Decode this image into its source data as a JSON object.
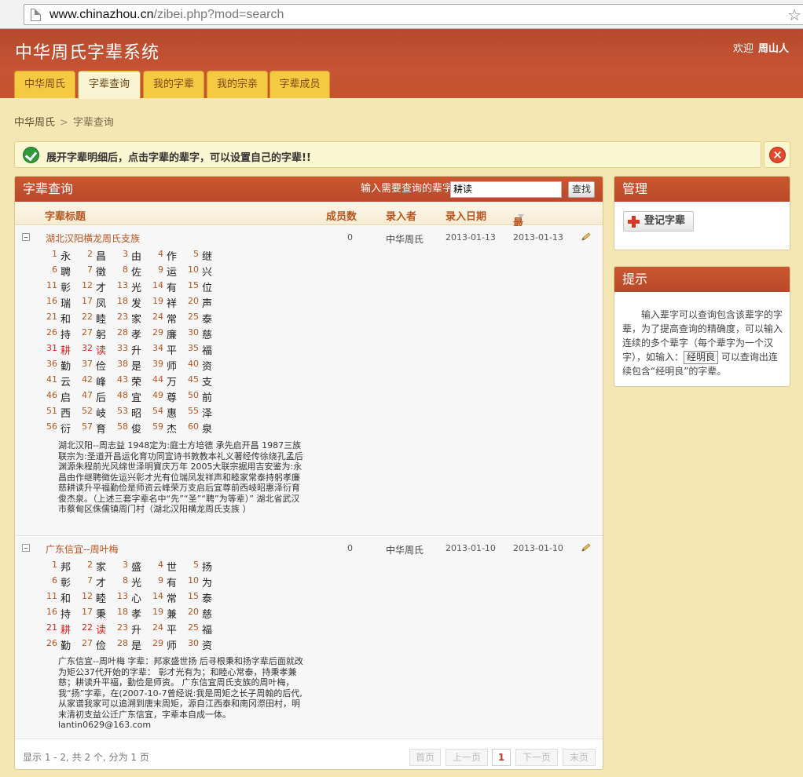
{
  "browser": {
    "url_host": "www.chinazhou.cn",
    "url_rest": "/zibei.php?mod=search"
  },
  "header": {
    "site_title": "中华周氏字辈系统",
    "welcome_label": "欢迎",
    "username": "周山人",
    "tabs": [
      {
        "label": "中华周氏",
        "active": false
      },
      {
        "label": "字辈查询",
        "active": true
      },
      {
        "label": "我的字辈",
        "active": false
      },
      {
        "label": "我的宗亲",
        "active": false
      },
      {
        "label": "字辈成员",
        "active": false
      }
    ]
  },
  "breadcrumb": {
    "home": "中华周氏",
    "sep": ">",
    "current": "字辈查询"
  },
  "notice": {
    "message": "展开字辈明细后，点击字辈的辈字，可以设置自己的字辈!!",
    "close": "×"
  },
  "search": {
    "title": "字辈查询",
    "label": "输入需要查询的辈字",
    "value": "耕读",
    "button": "查找"
  },
  "table": {
    "headers": {
      "title": "字辈标题",
      "count": "成员数",
      "by": "录入者",
      "date": "录入日期",
      "modified": "最后修改"
    },
    "rows": [
      {
        "title": "湖北汉阳横龙周氏支族",
        "count": "0",
        "by": "中华周氏",
        "date": "2013-01-13",
        "modified": "2013-01-13",
        "chars": [
          "永",
          "昌",
          "由",
          "作",
          "继",
          "聘",
          "徵",
          "佐",
          "运",
          "兴",
          "彰",
          "才",
          "光",
          "有",
          "位",
          "瑞",
          "凤",
          "发",
          "祥",
          "声",
          "和",
          "睦",
          "家",
          "常",
          "泰",
          "持",
          "躬",
          "孝",
          "廉",
          "慈",
          "耕",
          "读",
          "升",
          "平",
          "福",
          "勤",
          "俭",
          "是",
          "师",
          "资",
          "云",
          "峰",
          "荣",
          "万",
          "支",
          "启",
          "后",
          "宜",
          "尊",
          "前",
          "西",
          "岐",
          "昭",
          "惠",
          "泽",
          "衍",
          "育",
          "俊",
          "杰",
          "泉"
        ],
        "highlight": [
          31,
          32
        ],
        "desc": "湖北汉阳--周志益 1948定为:庭士方培德 承先启开昌 1987三族联宗为:圣道开昌运化育功同宣诗书敦教本礼义著经传徐绕孔孟后渊源朱程前光风绵世泽明寶庆万年 2005大联宗据用吉安鉴为:永昌由作继聘徵佐运兴彰才光有位瑞凤发祥声和睦家常泰持躬孝廉慈耕读升平福勤俭是师资云峰荣万支启后宜尊前西岐昭惠泽衍育俊杰泉。（上述三套字辈名中“先”“圣”“聘”为等辈）” 湖北省武汉市蔡甸区侏儒镇周门村（湖北汉阳横龙周氏支族 ）"
      },
      {
        "title": "广东信宜--周叶梅",
        "count": "0",
        "by": "中华周氏",
        "date": "2013-01-10",
        "modified": "2013-01-10",
        "chars": [
          "邦",
          "家",
          "盛",
          "世",
          "扬",
          "彰",
          "才",
          "光",
          "有",
          "为",
          "和",
          "睦",
          "心",
          "常",
          "泰",
          "持",
          "秉",
          "孝",
          "兼",
          "慈",
          "耕",
          "读",
          "升",
          "平",
          "福",
          "勤",
          "俭",
          "是",
          "师",
          "资"
        ],
        "highlight": [
          21,
          22
        ],
        "desc": "广东信宜--周叶梅 字辈：邦家盛世扬 后寻根秉和扬字辈后面就改为矩公37代开始的字辈： 彰才光有为；和睦心常泰，持秉孝兼慈；耕读升平福，勤俭是师资。 广东信宜周氏支族的周叶梅，我“扬”字辈，在(2007-10-7曾经说:我是周矩之长子周翰的后代,从家谱我家可以追溯到唐末周矩，源自江西泰和南冈漈田村，明末清初支益公迁广东信宜，字辈本自成一体。 lantin0629@163.com"
      }
    ]
  },
  "pager": {
    "info": "显示 1 - 2, 共 2 个, 分为 1 页",
    "first": "首页",
    "prev": "上一页",
    "current": "1",
    "next": "下一页",
    "last": "末页"
  },
  "manage": {
    "title": "管理",
    "button": "登记字辈"
  },
  "hint": {
    "title": "提示",
    "text_before": "输入辈字可以查询包含该辈字的字辈，为了提高查询的精确度，可以输入连续的多个辈字（每个辈字为一个汉字），如输入：",
    "example": "经明良",
    "text_after": "可以查询出连续包含“经明良”的字辈。"
  }
}
